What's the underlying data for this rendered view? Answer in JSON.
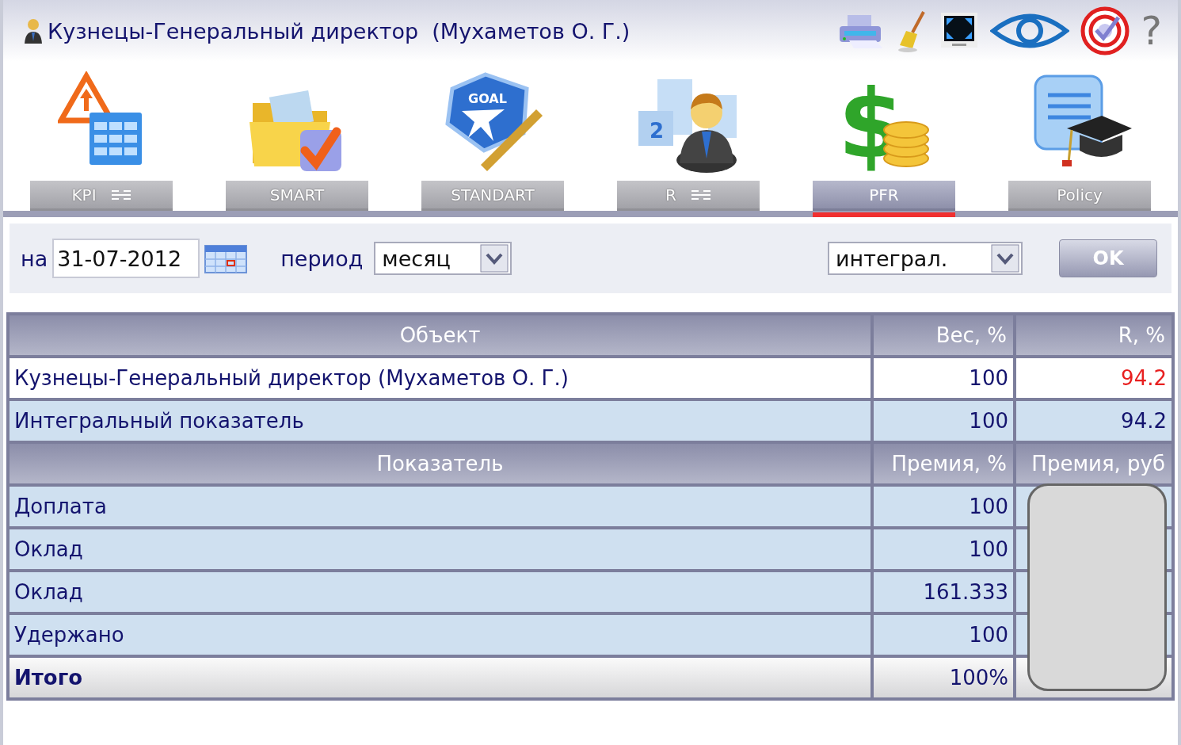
{
  "header": {
    "title": "Кузнецы-Генеральный директор  (Мухаметов О. Г.)",
    "help_label": "?"
  },
  "modules": [
    {
      "label": "KPI",
      "selected": false,
      "menu": true
    },
    {
      "label": "SMART",
      "selected": false,
      "menu": false
    },
    {
      "label": "STANDART",
      "selected": false,
      "menu": false,
      "icon_text": "GOAL"
    },
    {
      "label": "R",
      "selected": false,
      "menu": true,
      "icon_text": "2"
    },
    {
      "label": "PFR",
      "selected": true,
      "menu": false,
      "icon_text": "$"
    },
    {
      "label": "Policy",
      "selected": false,
      "menu": false
    }
  ],
  "filter": {
    "date_label": "на",
    "date_value": "31-07-2012",
    "period_label": "период",
    "period_value": "месяц",
    "mode_value": "интеграл.",
    "ok_button": "OK"
  },
  "objects": {
    "columns": [
      "Объект",
      "Вес, %",
      "R, %"
    ],
    "rows": [
      {
        "name": "Кузнецы-Генеральный директор (Мухаметов О. Г.)",
        "weight": "100",
        "r": "94.2",
        "selected": true,
        "alert": true
      },
      {
        "name": "Интегральный показатель",
        "weight": "100",
        "r": "94.2",
        "selected": false,
        "alert": false
      }
    ]
  },
  "indicators": {
    "columns": [
      "Показатель",
      "Премия, %",
      "Премия, руб"
    ],
    "rows": [
      {
        "name": "Доплата",
        "percent": "100"
      },
      {
        "name": "Оклад",
        "percent": "100"
      },
      {
        "name": "Оклад",
        "percent": "161.333"
      },
      {
        "name": "Удержано",
        "percent": "100"
      }
    ],
    "total": {
      "label": "Итого",
      "percent": "100%"
    },
    "rub_redacted": true
  }
}
